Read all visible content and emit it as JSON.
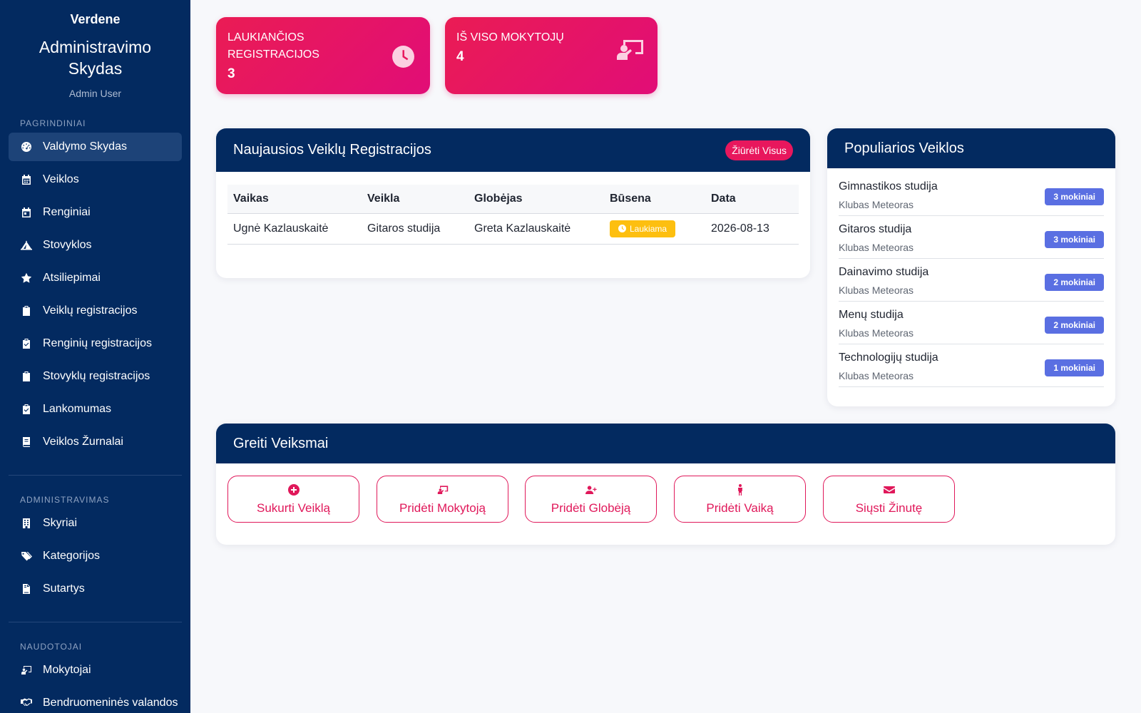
{
  "sidebar": {
    "brand": "Verdene",
    "title": "Administravimo Skydas",
    "user": "Admin User",
    "sections": [
      {
        "label": "PAGRINDINIAI"
      },
      {
        "label": "ADMINISTRAVIMAS"
      },
      {
        "label": "NAUDOTOJAI"
      }
    ],
    "items": [
      {
        "label": "Valdymo Skydas",
        "icon": "dashboard-icon"
      },
      {
        "label": "Veiklos",
        "icon": "calendar-icon"
      },
      {
        "label": "Renginiai",
        "icon": "calendar-day-icon"
      },
      {
        "label": "Stovyklos",
        "icon": "campground-icon"
      },
      {
        "label": "Atsiliepimai",
        "icon": "star-icon"
      },
      {
        "label": "Veiklų registracijos",
        "icon": "clipboard-list-icon"
      },
      {
        "label": "Renginių registracijos",
        "icon": "clipboard-check-icon"
      },
      {
        "label": "Stovyklų registracijos",
        "icon": "clipboard-list-icon"
      },
      {
        "label": "Lankomumas",
        "icon": "clipboard-check-icon"
      },
      {
        "label": "Veiklos Žurnalai",
        "icon": "book-icon"
      },
      {
        "label": "Skyriai",
        "icon": "building-icon"
      },
      {
        "label": "Kategorijos",
        "icon": "tags-icon"
      },
      {
        "label": "Sutartys",
        "icon": "file-contract-icon"
      },
      {
        "label": "Mokytojai",
        "icon": "chalkboard-teacher-icon"
      },
      {
        "label": "Bendruomeninės valandos",
        "icon": "handshake-icon"
      }
    ]
  },
  "stats": [
    {
      "label": "LAUKIANČIOS REGISTRACIJOS",
      "value": "3",
      "icon": "clock-icon"
    },
    {
      "label": "IŠ VISO MOKYTOJŲ",
      "value": "4",
      "icon": "chalkboard-teacher-icon"
    }
  ],
  "recent": {
    "title": "Naujausios Veiklų Registracijos",
    "view_all": "Žiūrėti Visus",
    "columns": [
      "Vaikas",
      "Veikla",
      "Globėjas",
      "Būsena",
      "Data"
    ],
    "rows": [
      {
        "child": "Ugnė Kazlauskaitė",
        "activity": "Gitaros studija",
        "guardian": "Greta Kazlauskaitė",
        "status": "Laukiama",
        "date": "2026-08-13"
      }
    ]
  },
  "popular": {
    "title": "Populiarios Veiklos",
    "items": [
      {
        "name": "Gimnastikos studija",
        "club": "Klubas Meteoras",
        "count": "3 mokiniai"
      },
      {
        "name": "Gitaros studija",
        "club": "Klubas Meteoras",
        "count": "3 mokiniai"
      },
      {
        "name": "Dainavimo studija",
        "club": "Klubas Meteoras",
        "count": "2 mokiniai"
      },
      {
        "name": "Menų studija",
        "club": "Klubas Meteoras",
        "count": "2 mokiniai"
      },
      {
        "name": "Technologijų studija",
        "club": "Klubas Meteoras",
        "count": "1 mokiniai"
      }
    ]
  },
  "quick": {
    "title": "Greiti Veiksmai",
    "actions": [
      {
        "label": "Sukurti Veiklą",
        "icon": "plus-circle-icon"
      },
      {
        "label": "Pridėti Mokytoją",
        "icon": "chalkboard-teacher-icon"
      },
      {
        "label": "Pridėti Globėją",
        "icon": "user-plus-icon"
      },
      {
        "label": "Pridėti Vaiką",
        "icon": "child-icon"
      },
      {
        "label": "Siųsti Žinutę",
        "icon": "envelope-icon"
      }
    ]
  },
  "colors": {
    "sidebar": "#032a60",
    "accent": "#e8175d",
    "badge_blue": "#5a6fe2",
    "warning": "#fdbf10"
  }
}
